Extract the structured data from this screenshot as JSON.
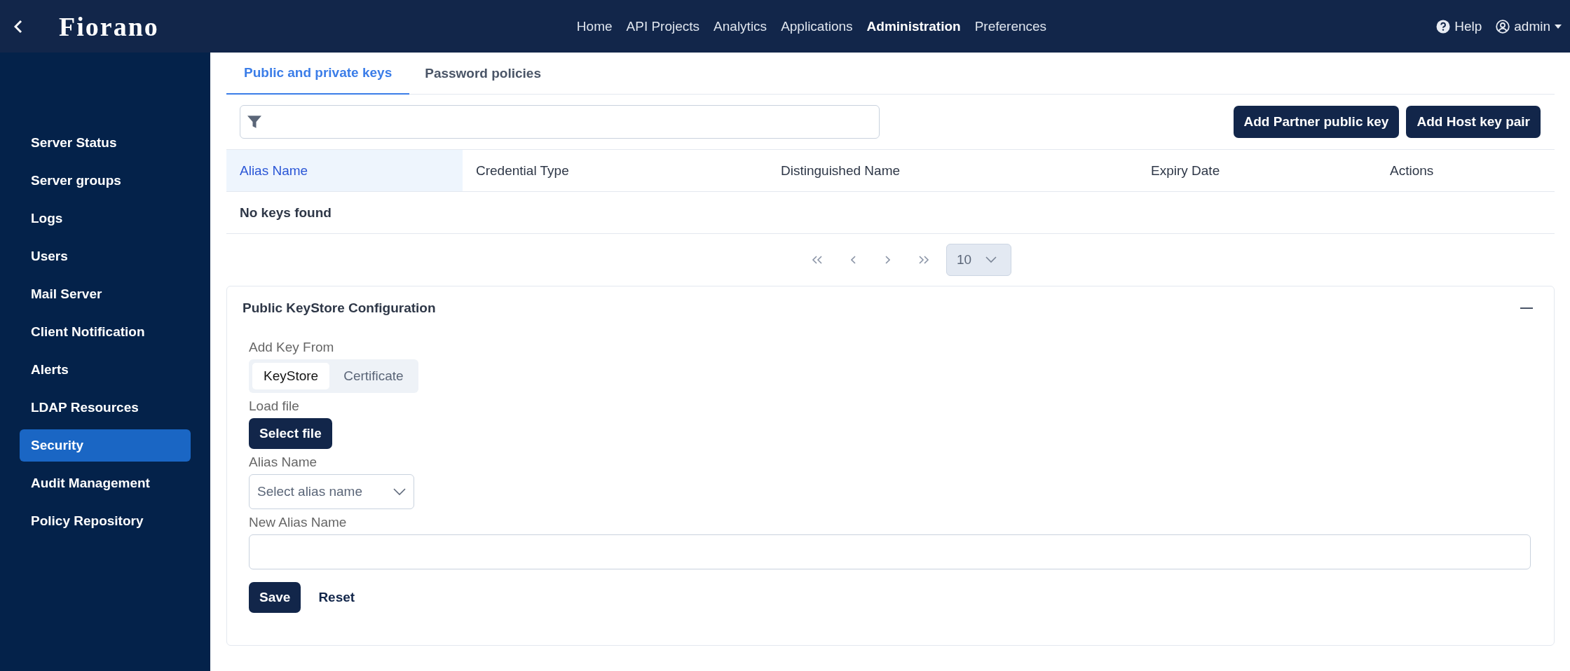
{
  "header": {
    "logo": "Fiorano",
    "nav": [
      {
        "label": "Home",
        "selected": false
      },
      {
        "label": "API Projects",
        "selected": false
      },
      {
        "label": "Analytics",
        "selected": false
      },
      {
        "label": "Applications",
        "selected": false
      },
      {
        "label": "Administration",
        "selected": true
      },
      {
        "label": "Preferences",
        "selected": false
      }
    ],
    "help": "Help",
    "user": "admin"
  },
  "sidebar": {
    "items": [
      {
        "label": "Server Status",
        "selected": false
      },
      {
        "label": "Server groups",
        "selected": false
      },
      {
        "label": "Logs",
        "selected": false
      },
      {
        "label": "Users",
        "selected": false
      },
      {
        "label": "Mail Server",
        "selected": false
      },
      {
        "label": "Client Notification",
        "selected": false
      },
      {
        "label": "Alerts",
        "selected": false
      },
      {
        "label": "LDAP Resources",
        "selected": false
      },
      {
        "label": "Security",
        "selected": true
      },
      {
        "label": "Audit Management",
        "selected": false
      },
      {
        "label": "Policy Repository",
        "selected": false
      }
    ]
  },
  "tabs": [
    {
      "label": "Public and private keys",
      "selected": true
    },
    {
      "label": "Password policies",
      "selected": false
    }
  ],
  "toolbar_buttons": [
    "Add Partner public key",
    "Add Host key pair"
  ],
  "table": {
    "columns": [
      {
        "label": "Alias Name",
        "sorted": true
      },
      {
        "label": "Credential Type",
        "sorted": false
      },
      {
        "label": "Distinguished Name",
        "sorted": false
      },
      {
        "label": "Expiry Date",
        "sorted": false
      },
      {
        "label": "Actions",
        "sorted": false
      }
    ],
    "empty_message": "No keys found"
  },
  "pagination": {
    "page_size": "10"
  },
  "panel": {
    "title": "Public KeyStore Configuration",
    "expanded": true,
    "add_key_from": {
      "label": "Add Key From",
      "options": [
        {
          "label": "KeyStore",
          "selected": true
        },
        {
          "label": "Certificate",
          "selected": false
        }
      ]
    },
    "load_file": {
      "label": "Load file",
      "button": "Select file"
    },
    "alias_name": {
      "label": "Alias Name",
      "placeholder": "Select alias name"
    },
    "new_alias_name": {
      "label": "New Alias Name"
    },
    "actions": [
      {
        "label": "Save",
        "kind": "primary"
      },
      {
        "label": "Reset",
        "kind": "plain"
      }
    ]
  }
}
